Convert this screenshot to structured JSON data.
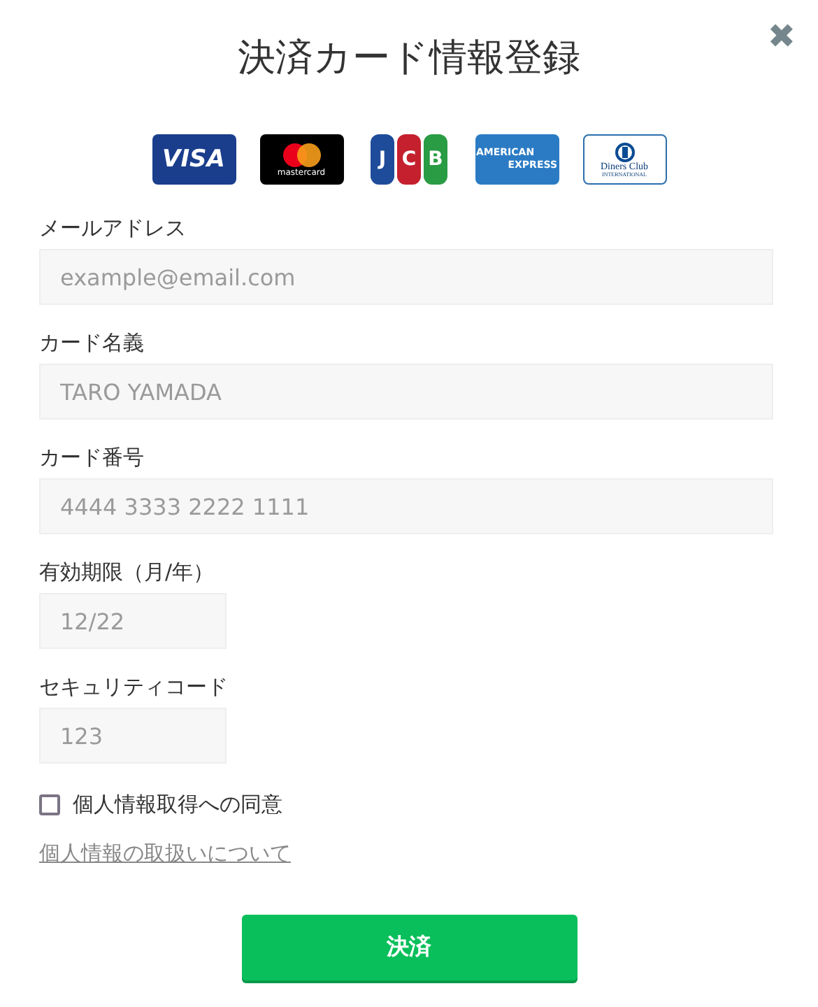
{
  "title": "決済カード情報登録",
  "close": {
    "label": "✖"
  },
  "cards": [
    {
      "kind": "visa",
      "texts": [
        "VISA"
      ]
    },
    {
      "kind": "mastercard",
      "texts": [
        "mastercard"
      ]
    },
    {
      "kind": "jcb",
      "texts": [
        "J",
        "C",
        "B"
      ]
    },
    {
      "kind": "amex",
      "texts": [
        "AMERICAN",
        "EXPRESS"
      ]
    },
    {
      "kind": "diners",
      "texts": [
        "Diners Club",
        "INTERNATIONAL"
      ]
    }
  ],
  "fields": [
    {
      "label": "メールアドレス",
      "placeholder": "example@email.com",
      "kind": "wide"
    },
    {
      "label": "カード名義",
      "placeholder": "TARO YAMADA",
      "kind": "wide"
    },
    {
      "label": "カード番号",
      "placeholder": "4444 3333 2222 1111",
      "kind": "wide"
    },
    {
      "label": "有効期限（月/年）",
      "placeholder": "12/22",
      "kind": "short"
    },
    {
      "label": "セキュリティコード",
      "placeholder": "123",
      "kind": "short"
    }
  ],
  "consent": {
    "label": "個人情報取得への同意",
    "checked": false
  },
  "privacy_link": "個人情報の取扱いについて",
  "submit": "決済"
}
